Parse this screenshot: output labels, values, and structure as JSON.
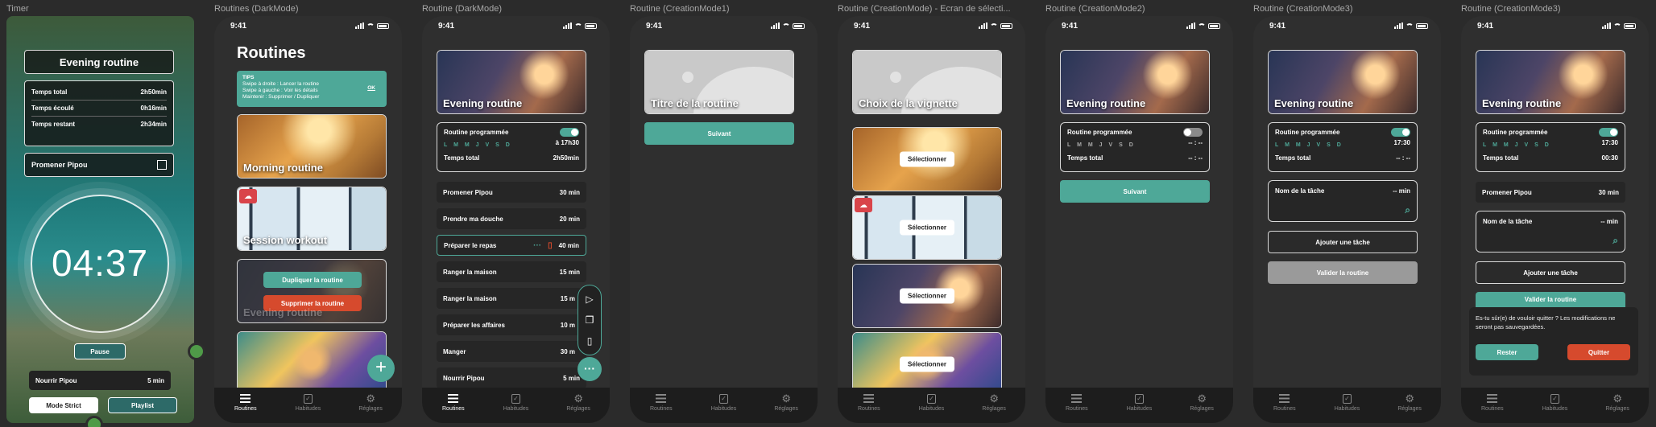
{
  "labels": [
    "Timer",
    "Routines (DarkMode)",
    "Routine (DarkMode)",
    "Routine (CreationMode1)",
    "Routine (CreationMode) - Ecran de sélecti...",
    "Routine (CreationMode2)",
    "Routine (CreationMode3)",
    "Routine (CreationMode3)"
  ],
  "time": "9:41",
  "nav": {
    "routines": "Routines",
    "habitudes": "Habitudes",
    "reglages": "Réglages"
  },
  "timer": {
    "title": "Evening routine",
    "rows": [
      {
        "label": "Temps total",
        "value": "2h50min"
      },
      {
        "label": "Temps écoulé",
        "value": "0h16min"
      },
      {
        "label": "Temps restant",
        "value": "2h34min"
      }
    ],
    "task": "Promener Pipou",
    "clock": "04:37",
    "pause": "Pause",
    "next_task": "Nourrir Pipou",
    "next_time": "5 min",
    "mode_strict": "Mode Strict",
    "playlist": "Playlist"
  },
  "routines": {
    "heading": "Routines",
    "tips_title": "TIPS",
    "tips_lines": [
      "Swipe à droite : Lancer la routine",
      "Swipe à gauche : Voir les détails",
      "Maintenir : Supprimer / Dupliquer"
    ],
    "tips_ok": "OK",
    "cards": [
      "Morning routine",
      "Session workout",
      "Evening routine"
    ],
    "duplicate": "Dupliquer la routine",
    "delete": "Supprimer la routine",
    "fab": "+"
  },
  "routine": {
    "card": "Evening routine",
    "prog_label": "Routine programmée",
    "days": "L M M J V S D",
    "prog_time": "à 17h30",
    "total_label": "Temps total",
    "total_value": "2h50min",
    "tasks": [
      {
        "name": "Promener Pipou",
        "time": "30 min"
      },
      {
        "name": "Prendre ma douche",
        "time": "20 min"
      },
      {
        "name": "Préparer le repas",
        "time": "40 min"
      },
      {
        "name": "Ranger la maison",
        "time": "15 min"
      },
      {
        "name": "Ranger la maison",
        "time": "15 m"
      },
      {
        "name": "Préparer les affaires",
        "time": "10 m"
      },
      {
        "name": "Manger",
        "time": "30 m"
      },
      {
        "name": "Nourrir Pipou",
        "time": "5 min"
      }
    ]
  },
  "create1": {
    "placeholder": "Titre de la routine",
    "next": "Suivant"
  },
  "select": {
    "heading": "Choix de la vignette",
    "select_btn": "Sélectionner"
  },
  "create2": {
    "card": "Evening routine",
    "prog_label": "Routine programmée",
    "days": "L M M J V S D",
    "time": "-- : --",
    "total_label": "Temps total",
    "total_value": "-- : --",
    "next": "Suivant"
  },
  "create3": {
    "card": "Evening routine",
    "prog_label": "Routine programmée",
    "days": "L M M J V S D",
    "time": "17:30",
    "total_label": "Temps total",
    "total_value": "-- : --",
    "task_label": "Nom de la tâche",
    "task_time": "-- min",
    "add": "Ajouter une tâche",
    "validate": "Valider la routine"
  },
  "create3b": {
    "card": "Evening routine",
    "prog_label": "Routine programmée",
    "days": "L M M J V S D",
    "time": "17:30",
    "total_label": "Temps total",
    "total_value": "00:30",
    "task1": "Promener Pipou",
    "task1_time": "30 min",
    "task_label": "Nom de la tâche",
    "task_time": "-- min",
    "add": "Ajouter une tâche",
    "validate": "Valider la routine",
    "dialog": "Es-tu sûr(e) de vouloir quitter ? Les modifications ne seront pas sauvegardées.",
    "stay": "Rester",
    "quit": "Quitter"
  }
}
